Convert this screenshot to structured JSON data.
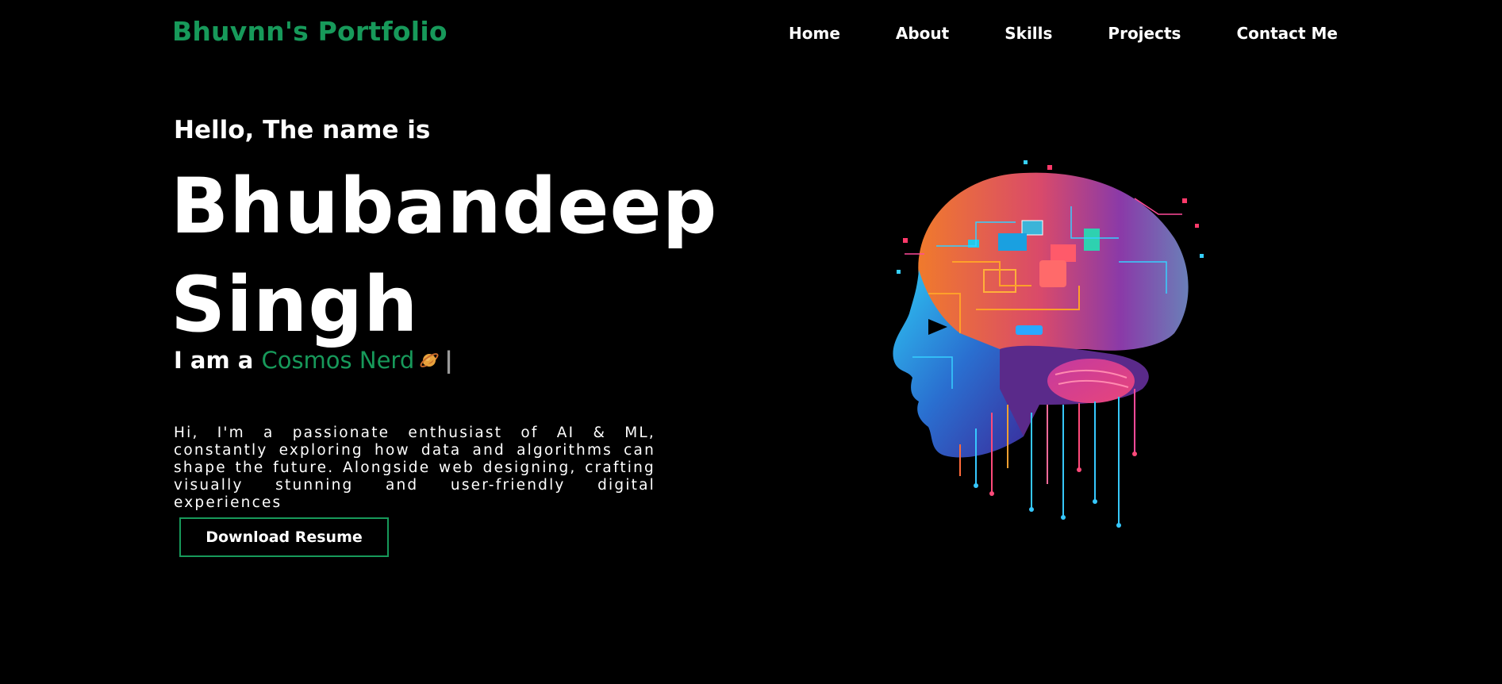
{
  "header": {
    "brand": "Bhuvnn's Portfolio",
    "nav": [
      "Home",
      "About",
      "Skills",
      "Projects",
      "Contact Me"
    ]
  },
  "hero": {
    "greeting": "Hello, The name is",
    "name_line1": "Bhubandeep",
    "name_line2": "Singh",
    "role_prefix": "I am a",
    "role_typed": "Cosmos Nerd",
    "role_icon": "ringed-planet-emoji",
    "cursor": "|",
    "bio": "Hi, I'm a passionate enthusiast of AI & ML, constantly exploring how data and algorithms can shape the future. Alongside web designing, crafting visually stunning and user-friendly digital experiences",
    "button_label": "Download Resume",
    "image": "ai-circuit-brain-head-illustration"
  },
  "colors": {
    "background": "#000000",
    "accent": "#17995a",
    "text": "#ffffff"
  }
}
